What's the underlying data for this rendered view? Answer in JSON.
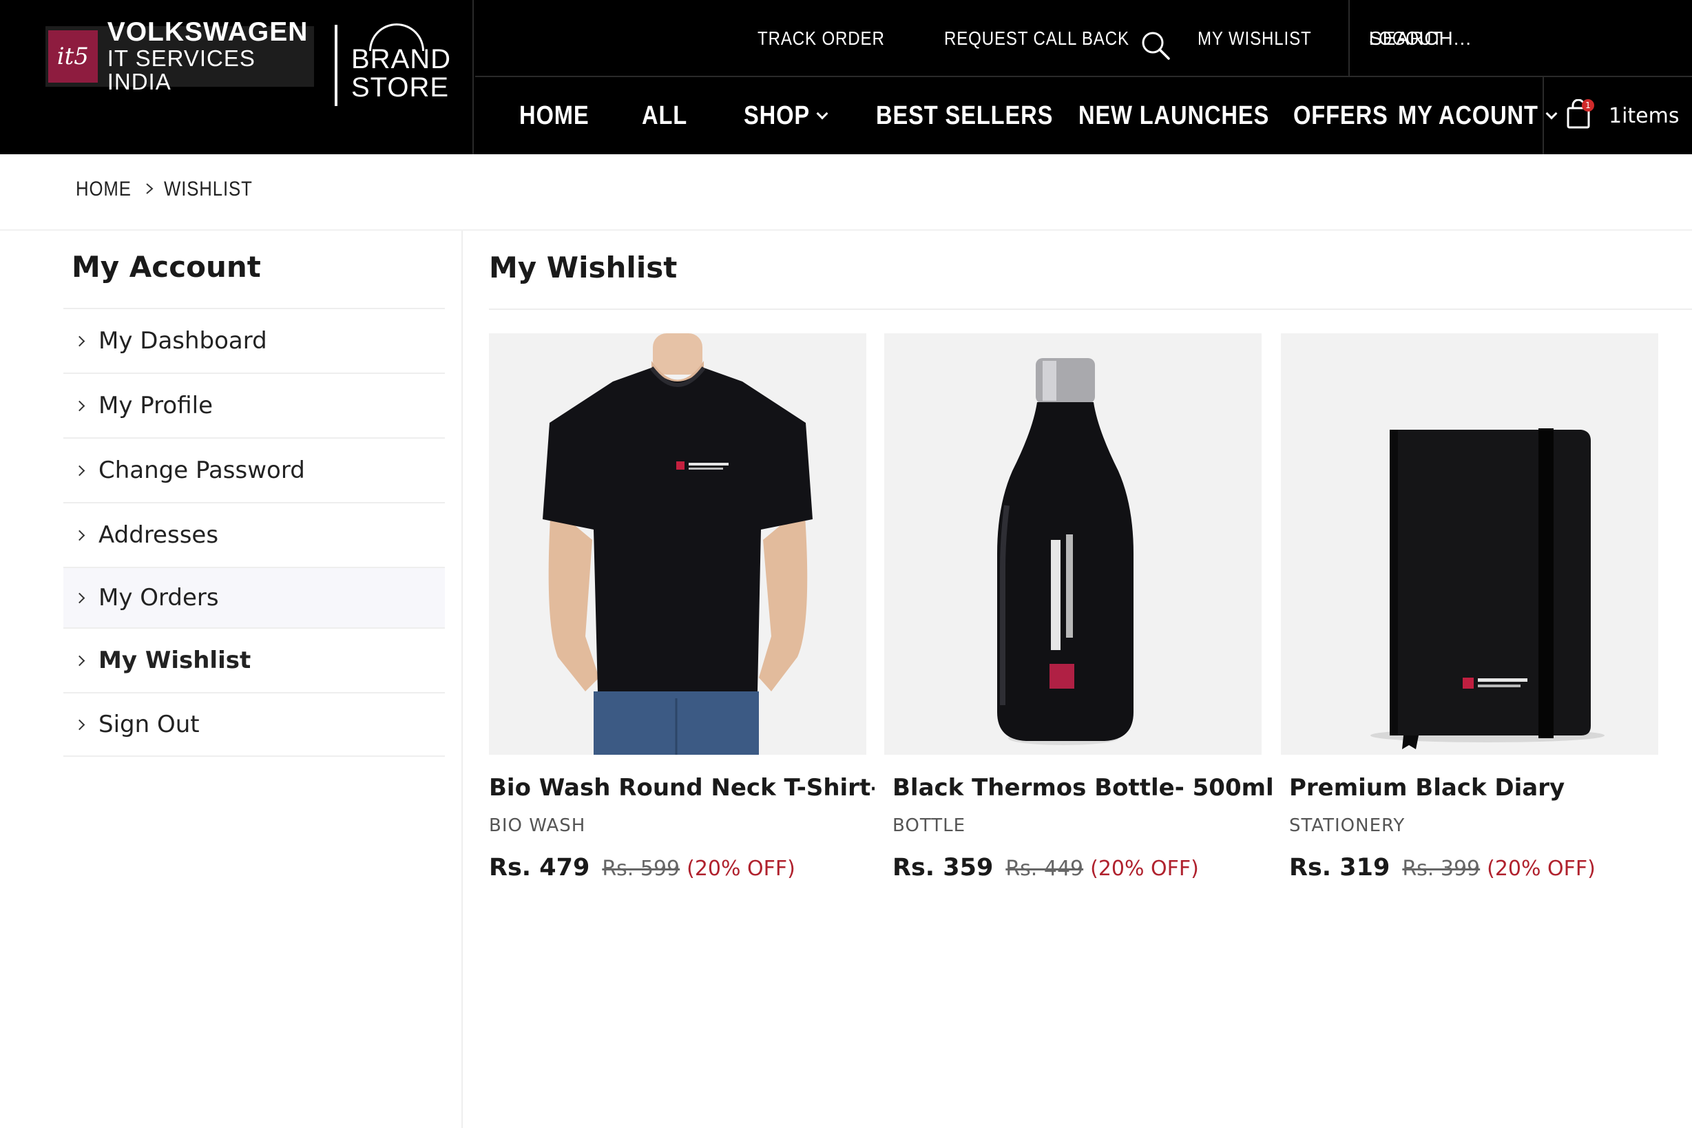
{
  "brand": {
    "logo_mark": "it5",
    "line1": "VOLKSWAGEN",
    "line2": "IT SERVICES INDIA",
    "store_line1": "BRAND",
    "store_line2": "STORE"
  },
  "toplinks": [
    "TRACK ORDER",
    "REQUEST CALL BACK",
    "MY WISHLIST",
    "LOGOUT"
  ],
  "search": {
    "placeholder": "SEARCH..."
  },
  "nav": {
    "home": "HOME",
    "all": "ALL",
    "shop": "SHOP",
    "best_sellers": "BEST SELLERS",
    "new_launches": "NEW LAUNCHES",
    "offers": "OFFERS",
    "my_account": "MY ACOUNT"
  },
  "cart": {
    "label": "1items",
    "badge": "1"
  },
  "breadcrumb": [
    "HOME",
    "WISHLIST"
  ],
  "sidebar": {
    "title": "My Account",
    "items": [
      "My Dashboard",
      "My Profile",
      "Change Password",
      "Addresses",
      "My Orders",
      "My Wishlist",
      "Sign Out"
    ]
  },
  "main": {
    "title": "My Wishlist",
    "products": [
      {
        "name": "Bio Wash Round Neck T-Shirt- Bl",
        "category": "BIO WASH",
        "price": "Rs. 479",
        "old_price": "Rs. 599",
        "discount": "(20% OFF)"
      },
      {
        "name": "Black Thermos Bottle- 500ml",
        "category": "BOTTLE",
        "price": "Rs. 359",
        "old_price": "Rs. 449",
        "discount": "(20% OFF)"
      },
      {
        "name": "Premium Black Diary",
        "category": "STATIONERY",
        "price": "Rs. 319",
        "old_price": "Rs. 399",
        "discount": "(20% OFF)"
      }
    ]
  },
  "colors": {
    "header_bg": "#000000",
    "brand_accent": "#8e1c3f",
    "discount": "#b0222e"
  }
}
